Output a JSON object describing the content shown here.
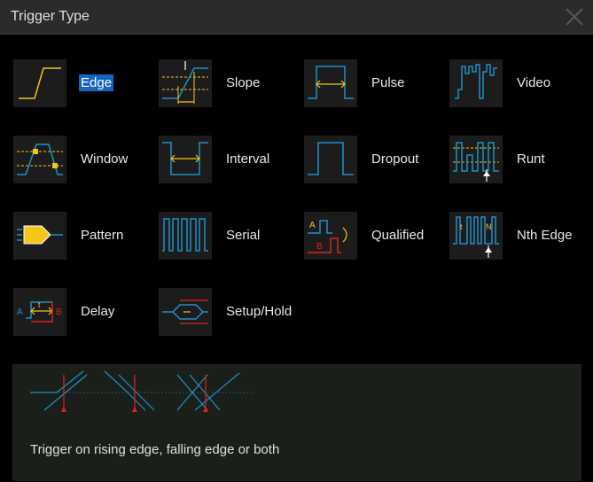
{
  "dialog": {
    "title": "Trigger Type"
  },
  "triggers": [
    {
      "label": "Edge",
      "icon": "edge-trigger-icon",
      "selected": true
    },
    {
      "label": "Slope",
      "icon": "slope-trigger-icon"
    },
    {
      "label": "Pulse",
      "icon": "pulse-trigger-icon"
    },
    {
      "label": "Video",
      "icon": "video-trigger-icon"
    },
    {
      "label": "Window",
      "icon": "window-trigger-icon"
    },
    {
      "label": "Interval",
      "icon": "interval-trigger-icon"
    },
    {
      "label": "Dropout",
      "icon": "dropout-trigger-icon"
    },
    {
      "label": "Runt",
      "icon": "runt-trigger-icon"
    },
    {
      "label": "Pattern",
      "icon": "pattern-trigger-icon"
    },
    {
      "label": "Serial",
      "icon": "serial-trigger-icon"
    },
    {
      "label": "Qualified",
      "icon": "qualified-trigger-icon"
    },
    {
      "label": "Nth Edge",
      "icon": "nth-edge-trigger-icon"
    },
    {
      "label": "Delay",
      "icon": "delay-trigger-icon"
    },
    {
      "label": "Setup/Hold",
      "icon": "setup-hold-trigger-icon"
    }
  ],
  "description": {
    "text": "Trigger on rising edge, falling edge or both"
  },
  "colors": {
    "accent": "#1565c0",
    "trace_yellow": "#f5c518",
    "trace_cyan": "#1e90c8",
    "marker_red": "#e02020"
  }
}
